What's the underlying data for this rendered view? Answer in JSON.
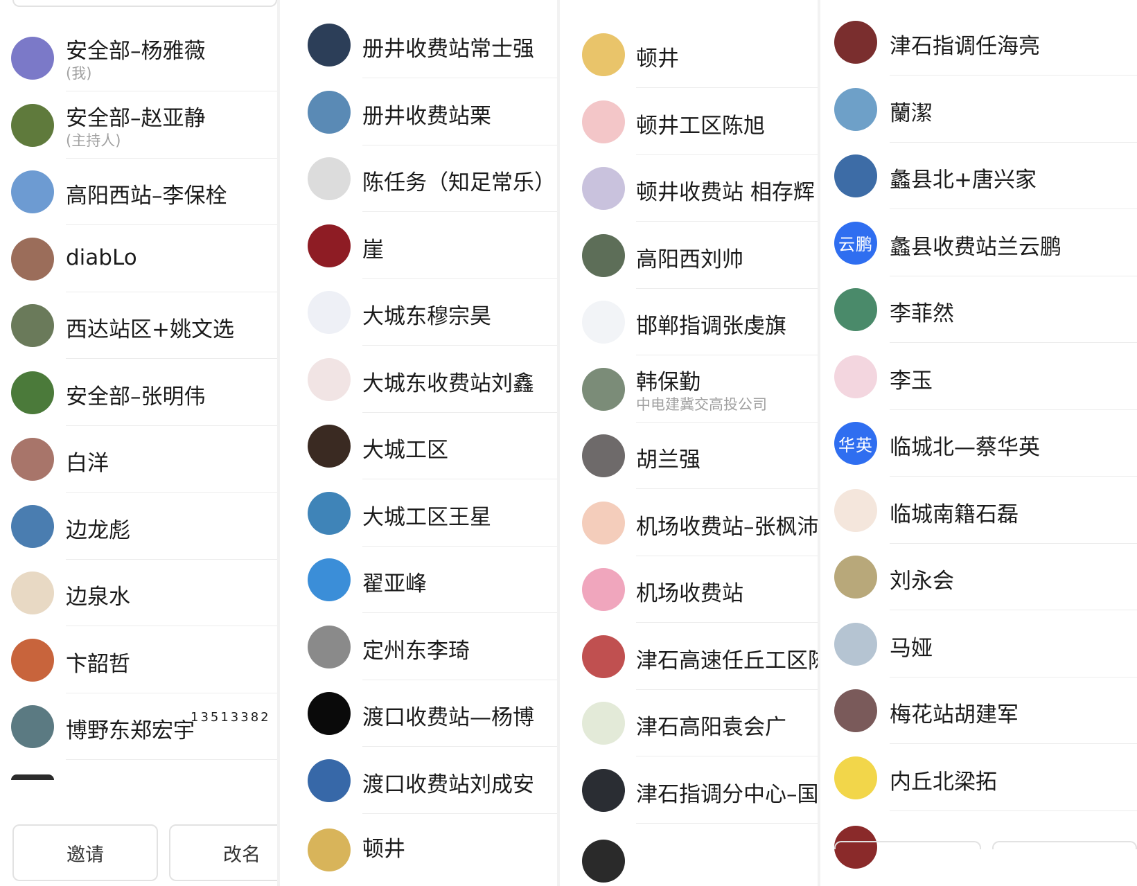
{
  "col1": {
    "items": [
      {
        "name": "安全部–杨雅薇",
        "sub": "(我)",
        "avatar_icon": "sky-photo-icon",
        "color": "#7b79c8"
      },
      {
        "name": "安全部–赵亚静",
        "sub": "(主持人)",
        "avatar_icon": "field-photo-icon",
        "color": "#5f7a3c"
      },
      {
        "name": "高阳西站–李保栓",
        "avatar_icon": "landscape-photo-icon",
        "color": "#6d9bd2"
      },
      {
        "name": "diabLo",
        "avatar_icon": "figurine-photo-icon",
        "color": "#9b6d5a"
      },
      {
        "name": "西达站区+姚文选",
        "avatar_icon": "mountain-photo-icon",
        "color": "#6a7a5a"
      },
      {
        "name": "安全部–张明伟",
        "avatar_icon": "vineyard-photo-icon",
        "color": "#4b7a3a"
      },
      {
        "name": "白洋",
        "avatar_icon": "hands-photo-icon",
        "color": "#a8756a"
      },
      {
        "name": "边龙彪",
        "avatar_icon": "lotus-pond-photo-icon",
        "color": "#4a7db0"
      },
      {
        "name": "边泉水",
        "avatar_icon": "seal-stamp-icon",
        "color": "#e8d9c4"
      },
      {
        "name": "卞韶哲",
        "avatar_icon": "cat-cartoon-icon",
        "color": "#c8643c"
      },
      {
        "name": "博野东郑宏宇",
        "suffix": "13513382",
        "avatar_icon": "outdoor-photo-icon",
        "color": "#5b7a82"
      }
    ],
    "buttons": {
      "invite": "邀请",
      "rename": "改名"
    }
  },
  "col2": {
    "items": [
      {
        "name": "册井收费站常士强",
        "avatar_icon": "portrait-photo-icon",
        "color": "#2c3e58"
      },
      {
        "name": "册井收费站栗",
        "avatar_icon": "mountain-sky-photo-icon",
        "color": "#5a8ab5"
      },
      {
        "name": "陈任务（知足常乐）",
        "avatar_icon": "default-avatar-icon",
        "color": "#dcdcdc"
      },
      {
        "name": "崖",
        "avatar_icon": "rose-heart-photo-icon",
        "color": "#8e1c24"
      },
      {
        "name": "大城东穆宗昊",
        "avatar_icon": "letter-m-logo-icon",
        "color": "#eef0f6"
      },
      {
        "name": "大城东收费站刘鑫",
        "avatar_icon": "sketch-figure-icon",
        "color": "#f1e4e4"
      },
      {
        "name": "大城工区",
        "avatar_icon": "dog-hoodie-photo-icon",
        "color": "#3a2a22"
      },
      {
        "name": "大城工区王星",
        "avatar_icon": "seaside-photo-icon",
        "color": "#3f84b8"
      },
      {
        "name": "翟亚峰",
        "avatar_icon": "sprout-sky-photo-icon",
        "color": "#3b8ed8"
      },
      {
        "name": "定州东李琦",
        "avatar_icon": "child-bw-photo-icon",
        "color": "#8a8a8a"
      },
      {
        "name": "渡口收费站—杨博",
        "avatar_icon": "black-circle-icon",
        "color": "#0a0a0a"
      },
      {
        "name": "渡口收费站刘成安",
        "avatar_icon": "grassland-photo-icon",
        "color": "#3768a8"
      }
    ],
    "cut_text": "顿井"
  },
  "col3": {
    "items": [
      {
        "name": "顿井",
        "avatar_icon": "anime-girl-icon",
        "color": "#e9c46a"
      },
      {
        "name": "顿井工区陈旭",
        "avatar_icon": "pink-dinosaur-icon",
        "color": "#f3c6c8"
      },
      {
        "name": "顿井收费站 相存辉",
        "avatar_icon": "bamboo-swing-icon",
        "color": "#c9c2dd"
      },
      {
        "name": "高阳西刘帅",
        "avatar_icon": "cartoon-character-icon",
        "color": "#5d6e58"
      },
      {
        "name": "邯郸指调张虔旗",
        "avatar_icon": "cartoon-man-icon",
        "color": "#f2f4f7"
      },
      {
        "name": "韩保勤",
        "sub": "中电建冀交高投公司",
        "avatar_icon": "park-photo-icon",
        "color": "#7b8c78"
      },
      {
        "name": "胡兰强",
        "avatar_icon": "sunset-photo-icon",
        "color": "#6e6a6a"
      },
      {
        "name": "机场收费站–张枫沛",
        "avatar_icon": "pig-cartoon-icon",
        "color": "#f4cdbb"
      },
      {
        "name": "机场收费站",
        "avatar_icon": "girl-photo-icon",
        "color": "#f0a6bd"
      },
      {
        "name": "津石高速任丘工区陈",
        "avatar_icon": "beach-photo-icon",
        "color": "#c05050"
      },
      {
        "name": "津石高阳袁会广",
        "avatar_icon": "calligraphy-icon",
        "color": "#e3ead8"
      },
      {
        "name": "津石指调分中心–国",
        "avatar_icon": "portrait-dark-icon",
        "color": "#2a2d33"
      }
    ]
  },
  "col4": {
    "items": [
      {
        "name": "津石指调任海亮",
        "avatar_icon": "woman-red-dress-icon",
        "color": "#7a2e2e"
      },
      {
        "name": "蘭潔",
        "avatar_icon": "lily-of-valley-icon",
        "color": "#6ea0c8"
      },
      {
        "name": "蠡县北+唐兴家",
        "avatar_icon": "baby-hat-icon",
        "color": "#3d6ca6"
      },
      {
        "name": "蠡县收费站兰云鹏",
        "avatar_text": "云鹏",
        "avatar_icon": "text-avatar-icon",
        "color": "#2f6ef0"
      },
      {
        "name": "李菲然",
        "avatar_icon": "illustration-icon",
        "color": "#4a8a6a"
      },
      {
        "name": "李玉",
        "avatar_icon": "anime-pink-icon",
        "color": "#f3d6df"
      },
      {
        "name": "临城北—蔡华英",
        "avatar_text": "华英",
        "avatar_icon": "text-avatar-icon",
        "color": "#2f6ef0"
      },
      {
        "name": "临城南籍石磊",
        "avatar_icon": "cartoon-boy-icon",
        "color": "#f4e6dc"
      },
      {
        "name": "刘永会",
        "avatar_icon": "temple-painting-icon",
        "color": "#b8a87a"
      },
      {
        "name": "马娅",
        "avatar_icon": "seascape-photo-icon",
        "color": "#b5c4d2"
      },
      {
        "name": "梅花站胡建军",
        "avatar_icon": "sunset-lake-icon",
        "color": "#7a5a5a"
      },
      {
        "name": "内丘北梁拓",
        "avatar_icon": "yellow-cartoon-face-icon",
        "color": "#f2d64a"
      }
    ]
  }
}
